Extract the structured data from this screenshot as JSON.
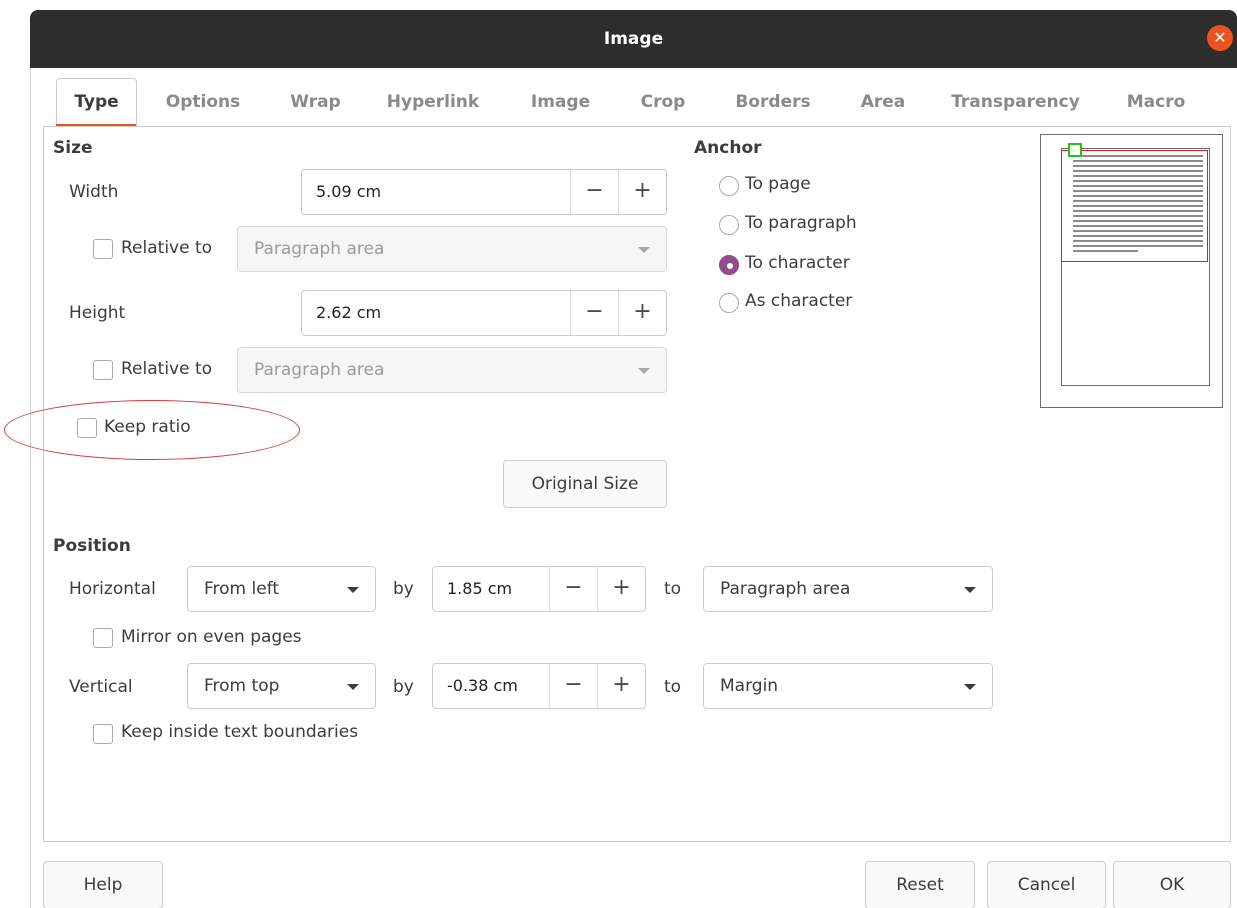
{
  "window": {
    "title": "Image",
    "close_icon": "close-icon",
    "accent": "#e95420"
  },
  "tabs": [
    {
      "label": "Type",
      "active": true
    },
    {
      "label": "Options"
    },
    {
      "label": "Wrap"
    },
    {
      "label": "Hyperlink"
    },
    {
      "label": "Image"
    },
    {
      "label": "Crop"
    },
    {
      "label": "Borders"
    },
    {
      "label": "Area"
    },
    {
      "label": "Transparency"
    },
    {
      "label": "Macro"
    }
  ],
  "size": {
    "title": "Size",
    "width_label": "Width",
    "width_value": "5.09 cm",
    "width_relative_label": "Relative to",
    "width_relative_checked": false,
    "width_relative_option": "Paragraph area",
    "height_label": "Height",
    "height_value": "2.62 cm",
    "height_relative_label": "Relative to",
    "height_relative_checked": false,
    "height_relative_option": "Paragraph area",
    "keep_ratio_label": "Keep ratio",
    "keep_ratio_checked": false,
    "original_size_label": "Original Size"
  },
  "spin": {
    "minus": "−",
    "plus": "+"
  },
  "anchor": {
    "title": "Anchor",
    "options": [
      {
        "label": "To page",
        "selected": false
      },
      {
        "label": "To paragraph",
        "selected": false
      },
      {
        "label": "To character",
        "selected": true
      },
      {
        "label": "As character",
        "selected": false
      }
    ]
  },
  "position": {
    "title": "Position",
    "horizontal_label": "Horizontal",
    "horizontal_option": "From left",
    "horizontal_by_label": "by",
    "horizontal_by_value": "1.85 cm",
    "horizontal_to_label": "to",
    "horizontal_to_option": "Paragraph area",
    "mirror_label": "Mirror on even pages",
    "mirror_checked": false,
    "vertical_label": "Vertical",
    "vertical_option": "From top",
    "vertical_by_label": "by",
    "vertical_by_value": "-0.38 cm",
    "vertical_to_label": "to",
    "vertical_to_option": "Margin",
    "keep_inside_label": "Keep inside text boundaries",
    "keep_inside_checked": false
  },
  "footer": {
    "help_label": "Help",
    "reset_label": "Reset",
    "cancel_label": "Cancel",
    "ok_label": "OK"
  }
}
